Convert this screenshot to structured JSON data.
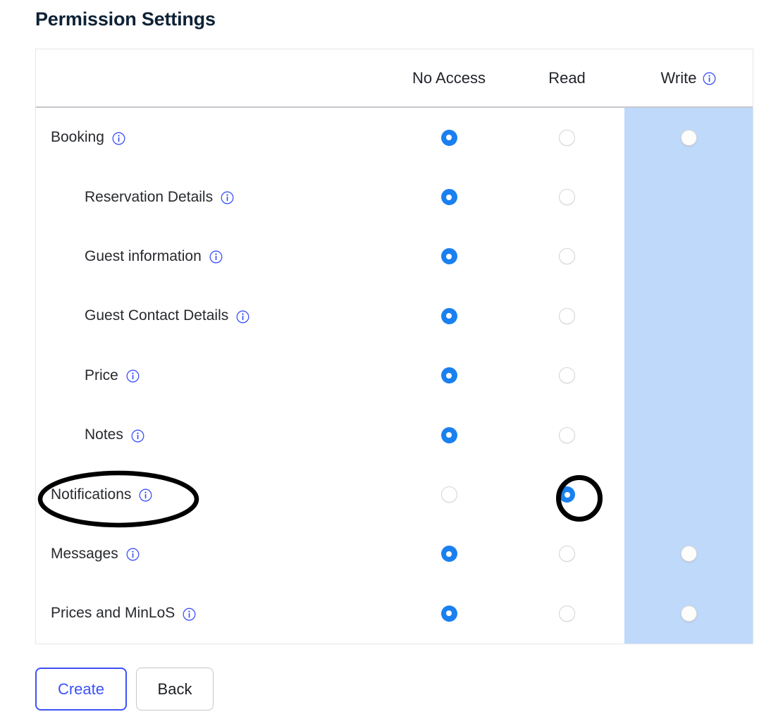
{
  "page": {
    "title": "Permission Settings"
  },
  "table": {
    "columns": [
      {
        "key": "no_access",
        "label": "No Access",
        "has_info": false
      },
      {
        "key": "read",
        "label": "Read",
        "has_info": false
      },
      {
        "key": "write",
        "label": "Write",
        "has_info": true,
        "highlighted": true
      }
    ],
    "rows": [
      {
        "label": "Booking",
        "indent": false,
        "no_access": "selected",
        "read": "unselected",
        "write": "disabled"
      },
      {
        "label": "Reservation Details",
        "indent": true,
        "no_access": "selected",
        "read": "unselected",
        "write": "none"
      },
      {
        "label": "Guest information",
        "indent": true,
        "no_access": "selected",
        "read": "unselected",
        "write": "none"
      },
      {
        "label": "Guest Contact Details",
        "indent": true,
        "no_access": "selected",
        "read": "unselected",
        "write": "none"
      },
      {
        "label": "Price",
        "indent": true,
        "no_access": "selected",
        "read": "unselected",
        "write": "none"
      },
      {
        "label": "Notes",
        "indent": true,
        "no_access": "selected",
        "read": "unselected",
        "write": "none"
      },
      {
        "label": "Notifications",
        "indent": false,
        "no_access": "unselected",
        "read": "selected",
        "write": "none"
      },
      {
        "label": "Messages",
        "indent": false,
        "no_access": "selected",
        "read": "unselected",
        "write": "disabled"
      },
      {
        "label": "Prices and MinLoS",
        "indent": false,
        "no_access": "selected",
        "read": "unselected",
        "write": "disabled"
      }
    ]
  },
  "buttons": {
    "create": "Create",
    "back": "Back"
  },
  "annotations": [
    {
      "name": "notifications-label-highlight",
      "shape": "ellipse",
      "target": "Notifications"
    },
    {
      "name": "notifications-read-radio-highlight",
      "shape": "circle",
      "target": "Read radio for Notifications"
    }
  ],
  "colors": {
    "title": "#0e2236",
    "accent_blue": "#1a80f0",
    "info_icon_blue": "#3d52f7",
    "create_border": "#3d52f7",
    "write_column_highlight": "#bfd9fb",
    "annotation": "#000000"
  },
  "icons": {
    "info": "info-icon"
  }
}
